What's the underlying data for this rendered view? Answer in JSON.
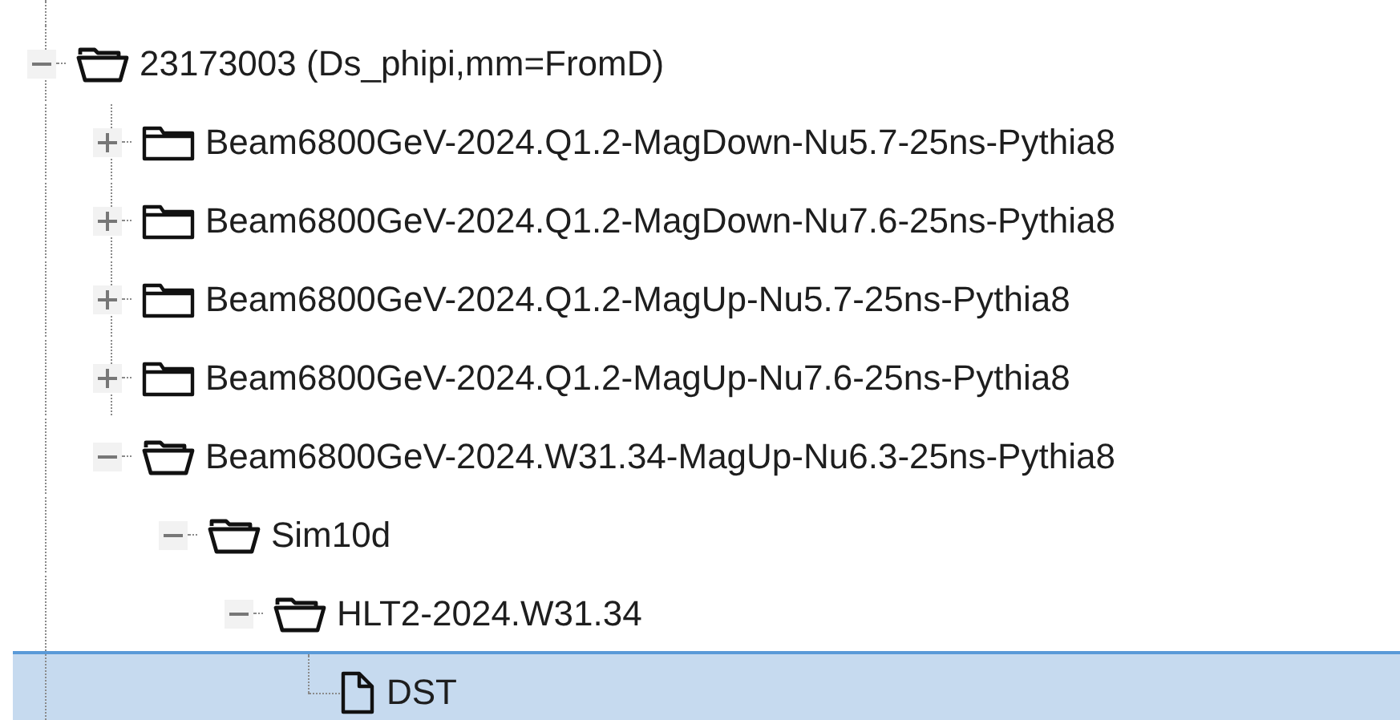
{
  "tree": [
    {
      "kind": "folder",
      "label": "23173003 (Ds_phipi,mm=FromD)",
      "expanded": true,
      "selected": false,
      "children": [
        {
          "kind": "folder",
          "label": "Beam6800GeV-2024.Q1.2-MagDown-Nu5.7-25ns-Pythia8",
          "expanded": false,
          "selected": false
        },
        {
          "kind": "folder",
          "label": "Beam6800GeV-2024.Q1.2-MagDown-Nu7.6-25ns-Pythia8",
          "expanded": false,
          "selected": false
        },
        {
          "kind": "folder",
          "label": "Beam6800GeV-2024.Q1.2-MagUp-Nu5.7-25ns-Pythia8",
          "expanded": false,
          "selected": false
        },
        {
          "kind": "folder",
          "label": "Beam6800GeV-2024.Q1.2-MagUp-Nu7.6-25ns-Pythia8",
          "expanded": false,
          "selected": false
        },
        {
          "kind": "folder",
          "label": "Beam6800GeV-2024.W31.34-MagUp-Nu6.3-25ns-Pythia8",
          "expanded": true,
          "selected": false,
          "children": [
            {
              "kind": "folder",
              "label": "Sim10d",
              "expanded": true,
              "selected": false,
              "children": [
                {
                  "kind": "folder",
                  "label": "HLT2-2024.W31.34",
                  "expanded": true,
                  "selected": false,
                  "children": [
                    {
                      "kind": "file",
                      "label": "DST",
                      "selected": true
                    }
                  ]
                }
              ]
            }
          ]
        }
      ]
    }
  ]
}
